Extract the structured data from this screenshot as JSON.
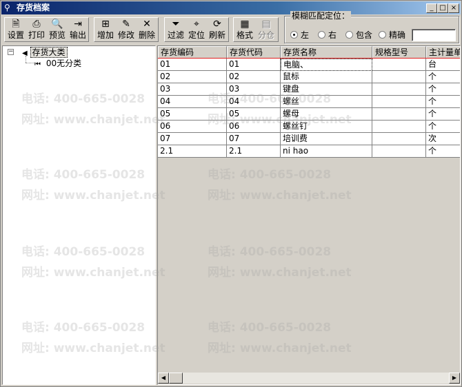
{
  "window": {
    "title": "存货档案",
    "controls": [
      "_",
      "□",
      "×"
    ]
  },
  "toolbar": {
    "buttons": [
      {
        "label": "设置",
        "icon": "settings-doc-icon"
      },
      {
        "label": "打印",
        "icon": "printer-icon"
      },
      {
        "label": "预览",
        "icon": "preview-icon"
      },
      {
        "label": "输出",
        "icon": "export-icon"
      },
      {
        "label": "增加",
        "icon": "add-icon"
      },
      {
        "label": "修改",
        "icon": "edit-icon"
      },
      {
        "label": "删除",
        "icon": "delete-icon"
      },
      {
        "label": "过滤",
        "icon": "filter-icon"
      },
      {
        "label": "定位",
        "icon": "locate-icon"
      },
      {
        "label": "刷新",
        "icon": "refresh-icon"
      },
      {
        "label": "格式",
        "icon": "format-icon"
      },
      {
        "label": "分仓",
        "icon": "warehouse-icon",
        "disabled": true
      }
    ]
  },
  "match": {
    "legend": "模糊匹配定位：",
    "options": [
      "左",
      "右",
      "包含",
      "精确"
    ],
    "selected": "左",
    "value": ""
  },
  "tree": {
    "root": "存货大类",
    "child": "00无分类"
  },
  "table": {
    "columns": [
      "存货编码",
      "存货代码",
      "存货名称",
      "规格型号",
      "主计量单"
    ],
    "rows": [
      [
        "01",
        "01",
        "电脑、",
        "",
        "台"
      ],
      [
        "02",
        "02",
        "鼠标",
        "",
        "个"
      ],
      [
        "03",
        "03",
        "键盘",
        "",
        "个"
      ],
      [
        "04",
        "04",
        "螺丝",
        "",
        "个"
      ],
      [
        "05",
        "05",
        "螺母",
        "",
        "个"
      ],
      [
        "06",
        "06",
        "螺丝钉",
        "",
        "个"
      ],
      [
        "07",
        "07",
        "培训费",
        "",
        "次"
      ],
      [
        "2.1",
        "2.1",
        "ni hao",
        "",
        "个"
      ]
    ],
    "selected_row": 0
  },
  "watermark": {
    "phone": "电话: 400-665-0028",
    "site": "网址: www.chanjet.net",
    "color": "#a0a0a0"
  },
  "colors": {
    "title_start": "#0a246a",
    "title_end": "#a6caf0",
    "highlight": "#e02020",
    "face": "#d4d0c8"
  }
}
